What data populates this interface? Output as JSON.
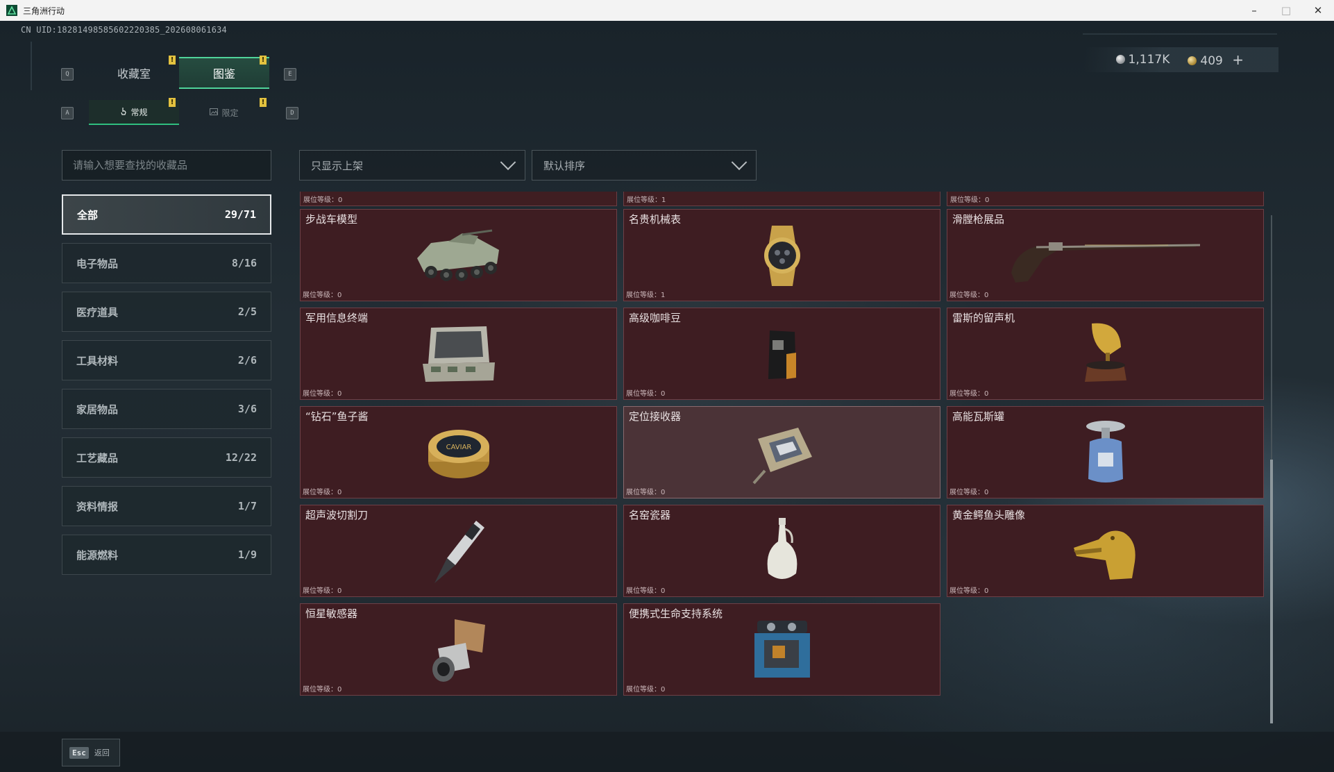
{
  "window": {
    "title": "三角洲行动",
    "minimize": "–",
    "maximize": "□",
    "close": "✕"
  },
  "header": {
    "uid": "CN UID:18281498585602220385_202608061634"
  },
  "currency": {
    "silver": "1,117K",
    "gold": "409",
    "add": "+"
  },
  "tabs": {
    "main": [
      {
        "label": "收藏室",
        "key": "Q"
      },
      {
        "label": "图鉴",
        "key": "E"
      }
    ],
    "sub": [
      {
        "label": "常规",
        "key": "A"
      },
      {
        "label": "限定",
        "key": "D"
      }
    ],
    "alert": "!"
  },
  "search": {
    "placeholder": "请输入想要查找的收藏品"
  },
  "filters": {
    "shelf": "只显示上架",
    "sort": "默认排序"
  },
  "categories": [
    {
      "label": "全部",
      "count": "29/71"
    },
    {
      "label": "电子物品",
      "count": "8/16"
    },
    {
      "label": "医疗道具",
      "count": "2/5"
    },
    {
      "label": "工具材料",
      "count": "2/6"
    },
    {
      "label": "家居物品",
      "count": "3/6"
    },
    {
      "label": "工艺藏品",
      "count": "12/22"
    },
    {
      "label": "资料情报",
      "count": "1/7"
    },
    {
      "label": "能源燃料",
      "count": "1/9"
    }
  ],
  "partial_row": [
    "展位等级：0",
    "展位等级：1",
    "展位等级：0"
  ],
  "items": [
    {
      "name": "步战车模型",
      "level": "展位等级：0",
      "icon": "ifv-model-icon"
    },
    {
      "name": "名贵机械表",
      "level": "展位等级：1",
      "icon": "watch-icon"
    },
    {
      "name": "滑膛枪展品",
      "level": "展位等级：0",
      "icon": "musket-icon"
    },
    {
      "name": "军用信息终端",
      "level": "展位等级：0",
      "icon": "terminal-icon"
    },
    {
      "name": "高级咖啡豆",
      "level": "展位等级：0",
      "icon": "coffee-bag-icon"
    },
    {
      "name": "雷斯的留声机",
      "level": "展位等级：0",
      "icon": "gramophone-icon"
    },
    {
      "name": "“钻石”鱼子酱",
      "level": "展位等级：0",
      "icon": "caviar-tin-icon",
      "tin_text": "CAVIAR"
    },
    {
      "name": "定位接收器",
      "level": "展位等级：0",
      "icon": "gps-receiver-icon"
    },
    {
      "name": "高能瓦斯罐",
      "level": "展位等级：0",
      "icon": "gas-canister-icon"
    },
    {
      "name": "超声波切割刀",
      "level": "展位等级：0",
      "icon": "ultrasonic-knife-icon"
    },
    {
      "name": "名窑瓷器",
      "level": "展位等级：0",
      "icon": "porcelain-vase-icon"
    },
    {
      "name": "黄金鳄鱼头雕像",
      "level": "展位等级：0",
      "icon": "gold-croc-head-icon"
    },
    {
      "name": "恒星敏感器",
      "level": "展位等级：0",
      "icon": "star-sensor-icon"
    },
    {
      "name": "便携式生命支持系统",
      "level": "展位等级：0",
      "icon": "life-support-icon"
    }
  ],
  "footer": {
    "esc_key": "Esc",
    "back_label": "返回"
  }
}
